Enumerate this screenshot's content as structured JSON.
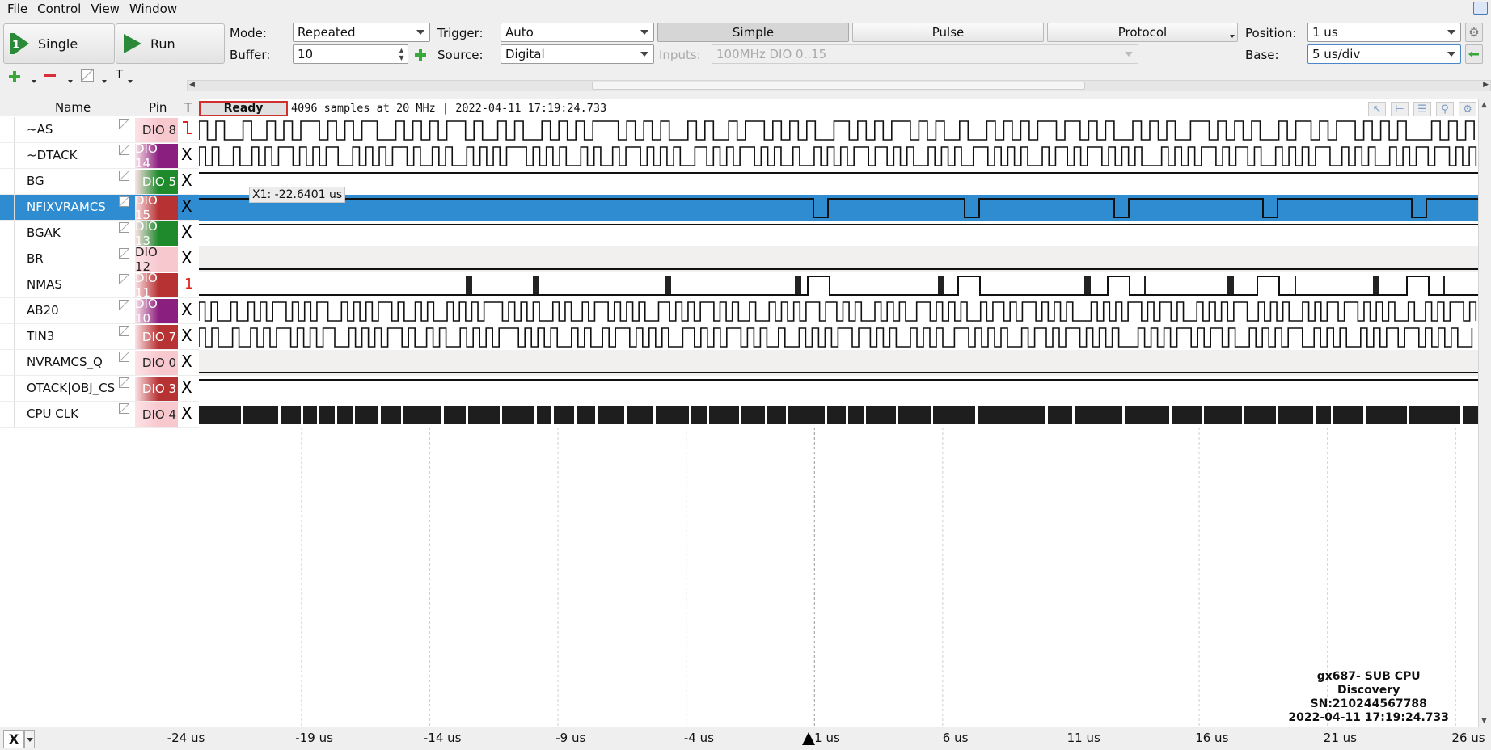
{
  "menu": [
    "File",
    "Control",
    "View",
    "Window"
  ],
  "toolbar": {
    "single_label": "Single",
    "run_label": "Run",
    "mode_label": "Mode:",
    "mode_value": "Repeated",
    "buffer_label": "Buffer:",
    "buffer_value": "10",
    "trigger_label": "Trigger:",
    "trigger_value": "Auto",
    "source_label": "Source:",
    "source_value": "Digital",
    "inputs_label": "Inputs:",
    "inputs_value": "100MHz DIO 0..15",
    "tabs": [
      "Simple",
      "Pulse",
      "Protocol"
    ],
    "active_tab": "Simple",
    "position_label": "Position:",
    "position_value": "1 us",
    "base_label": "Base:",
    "base_value": "5 us/div"
  },
  "table": {
    "headers": {
      "name": "Name",
      "pin": "Pin",
      "trigger": "T"
    },
    "rows": [
      {
        "name": "~AS",
        "pin": "DIO 8",
        "pin_color": "#f8c8cf",
        "pin_text": "#222",
        "trigger": "fall",
        "trace": "clock",
        "selected": false
      },
      {
        "name": "~DTACK",
        "pin": "DIO 14",
        "pin_color": "#8b1f7f",
        "pin_text": "#fff",
        "trigger": "X",
        "trace": "clock",
        "selected": false
      },
      {
        "name": "BG",
        "pin": "DIO 5",
        "pin_color": "#1f8a2c",
        "pin_text": "#fff",
        "trigger": "X",
        "trace": "high",
        "selected": false
      },
      {
        "name": "NFIXVRAMCS",
        "pin": "DIO 15",
        "pin_color": "#b63233",
        "pin_text": "#fff",
        "trigger": "X",
        "trace": "high_dips",
        "selected": true
      },
      {
        "name": "BGAK",
        "pin": "DIO 13",
        "pin_color": "#1f8a2c",
        "pin_text": "#fff",
        "trigger": "X",
        "trace": "high",
        "selected": false
      },
      {
        "name": "BR",
        "pin": "DIO 12",
        "pin_color": "#f8c8cf",
        "pin_text": "#222",
        "trigger": "X",
        "trace": "low",
        "selected": false
      },
      {
        "name": "NMAS",
        "pin": "DIO 11",
        "pin_color": "#b63233",
        "pin_text": "#fff",
        "trigger": "1",
        "trace": "pulses",
        "selected": false
      },
      {
        "name": "AB20",
        "pin": "DIO 10",
        "pin_color": "#8b1f7f",
        "pin_text": "#fff",
        "trigger": "X",
        "trace": "clock",
        "selected": false
      },
      {
        "name": "TIN3",
        "pin": "DIO 7",
        "pin_color": "#b63233",
        "pin_text": "#fff",
        "trigger": "X",
        "trace": "clock",
        "selected": false
      },
      {
        "name": "NVRAMCS_Q",
        "pin": "DIO 0",
        "pin_color": "#f8c8cf",
        "pin_text": "#222",
        "trigger": "X",
        "trace": "low",
        "selected": false
      },
      {
        "name": "OTACK|OBJ_CS",
        "pin": "DIO 3",
        "pin_color": "#b63233",
        "pin_text": "#fff",
        "trigger": "X",
        "trace": "high",
        "selected": false
      },
      {
        "name": "CPU CLK",
        "pin": "DIO 4",
        "pin_color": "#f8c8cf",
        "pin_text": "#222",
        "trigger": "X",
        "trace": "dense",
        "selected": false
      }
    ]
  },
  "status": {
    "ready": "Ready",
    "info": "4096 samples at 20 MHz | 2022-04-11 17:19:24.733"
  },
  "cursor_label": "X1: -22.6401 us",
  "time_axis": [
    "-24 us",
    "-19 us",
    "-14 us",
    "-9 us",
    "-4 us",
    "1 us",
    "6 us",
    "11 us",
    "16 us",
    "21 us",
    "26 us"
  ],
  "device": {
    "line1": "gx687- SUB CPU",
    "line2": "Discovery",
    "line3": "SN:210244567788",
    "line4": "2022-04-11 17:19:24.733"
  },
  "bottom": {
    "x_label": "X"
  },
  "colors": {
    "selected_row": "#2f8cd0",
    "trigger_red": "#e0201a"
  }
}
